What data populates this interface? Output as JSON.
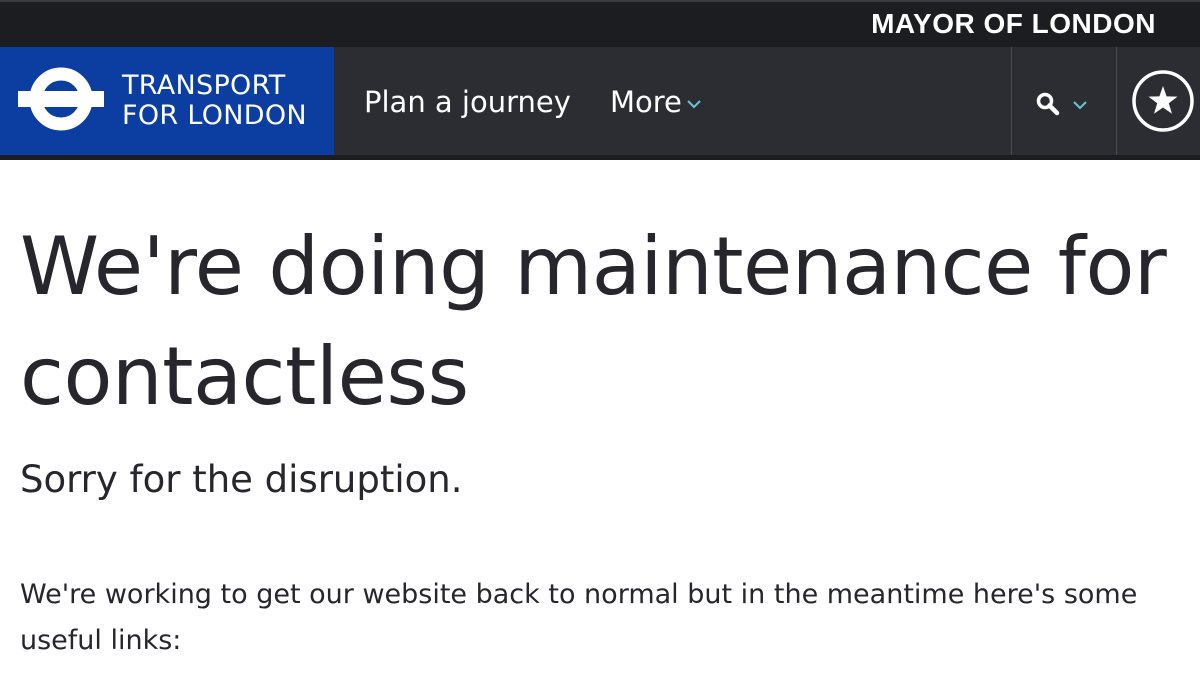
{
  "mayor_bar": {
    "text": "MAYOR OF LONDON"
  },
  "nav": {
    "logo_line1": "TRANSPORT",
    "logo_line2": "FOR LONDON",
    "links": [
      {
        "label": "Plan a journey"
      },
      {
        "label": "More"
      }
    ],
    "icons": {
      "logo": "tfl-roundel-icon",
      "more_chevron": "chevron-down-icon",
      "search": "search-icon",
      "search_chevron": "chevron-down-icon",
      "favourites": "star-icon"
    }
  },
  "content": {
    "headline": "We're doing maintenance for contactless",
    "subheading": "Sorry for the disruption.",
    "body": "We're working to get our website back to normal but in the meantime here's some useful links:"
  },
  "colors": {
    "brand_blue": "#0c3ea1",
    "nav_background": "#2b2d33",
    "mayor_bar_background": "#1c1d20",
    "accent_teal": "#6cc4d4",
    "text": "#26262c"
  }
}
